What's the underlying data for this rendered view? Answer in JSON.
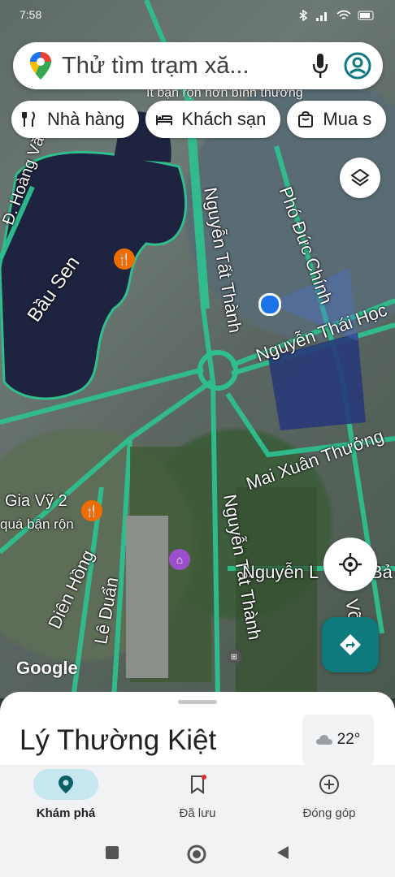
{
  "status_bar": {
    "time": "7:58"
  },
  "search": {
    "placeholder": "Thử tìm trạm xă..."
  },
  "top_note": "It bận rộn hơn bình thường",
  "chips": [
    {
      "label": "Nhà hàng",
      "icon": "restaurant-icon"
    },
    {
      "label": "Khách sạn",
      "icon": "hotel-icon"
    },
    {
      "label": "Mua s",
      "icon": "shopping-icon"
    }
  ],
  "map_labels": {
    "hoang_van": "Đ. Hoàng Văn",
    "bau_sen": "Bầu Sen",
    "nguyen_tat_thanh_1": "Nguyễn Tất Thành",
    "pho_duc_chinh": "Phó Đức Chính",
    "nguyen_thai_hoc": "Nguyễn Thái Học",
    "mai_xuan_thuong": "Mai Xuân Thưởng",
    "gia_vy": "Gia Vỹ 2",
    "qua_ban_ron": "quá bận rộn",
    "dien_hong": "Diên Hồng",
    "le_duan": "Lê Duẩn",
    "nguyen_tat_thanh_2": "Nguyễn Tất Thành",
    "nguyen_l_ba": "Nguyễn L",
    "ba": "Bả",
    "vo": "Võ"
  },
  "google_logo": "Google",
  "place": {
    "name": "Lý Thường Kiệt",
    "weather": "22°"
  },
  "bottom_nav": [
    {
      "label": "Khám phá",
      "icon": "explore-pin-icon",
      "active": true
    },
    {
      "label": "Đã lưu",
      "icon": "bookmark-icon",
      "active": false
    },
    {
      "label": "Đóng góp",
      "icon": "add-circle-icon",
      "active": false
    }
  ],
  "colors": {
    "teal": "#0e7a7d",
    "road": "#2fbf8f",
    "user_dot": "#1a73e8"
  }
}
